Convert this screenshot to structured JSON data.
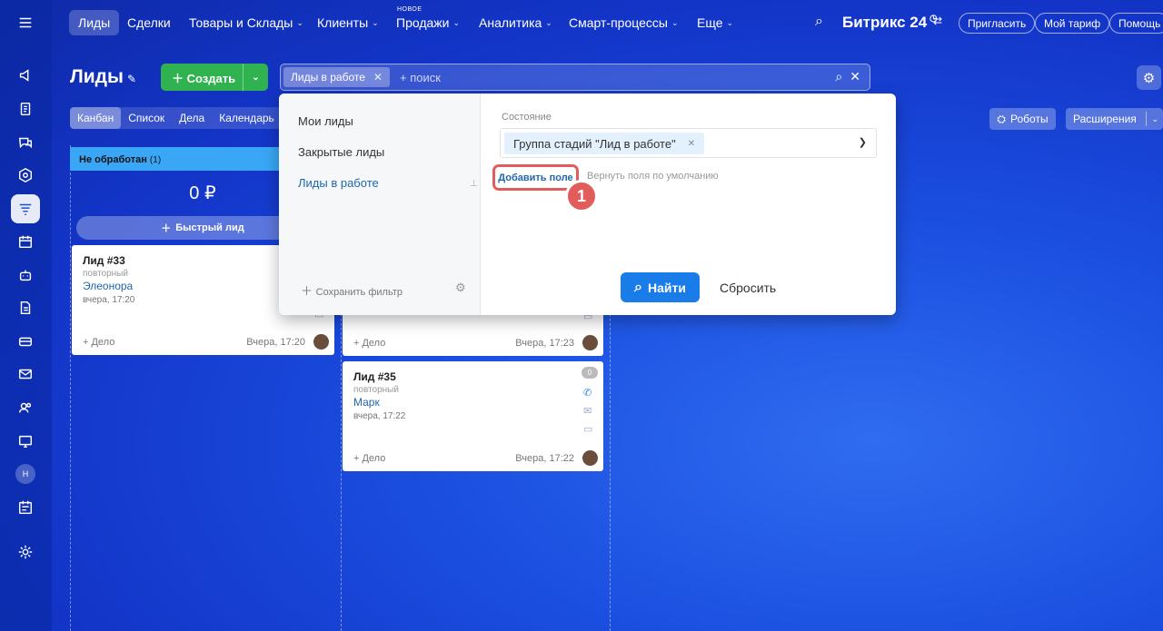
{
  "rail": {
    "icons": [
      "menu-icon",
      "megaphone-icon",
      "document-icon",
      "chat-icon",
      "hexagon-icon",
      "funnel-icon",
      "calendar-icon",
      "robot-icon",
      "file-icon",
      "card-icon",
      "mail-icon",
      "users-icon",
      "screen-icon",
      "avatar",
      "tasks-icon",
      "settings-icon"
    ],
    "avatar_initial": "Н"
  },
  "topnav": {
    "items": [
      {
        "label": "Лиды",
        "active": true
      },
      {
        "label": "Сделки"
      },
      {
        "label": "Товары и Склады",
        "chev": true
      },
      {
        "label": "Клиенты",
        "chev": true
      },
      {
        "label": "Продажи",
        "chev": true
      },
      {
        "label": "Аналитика",
        "chev": true
      },
      {
        "label": "Смарт-процессы",
        "chev": true
      },
      {
        "label": "Еще",
        "chev": true
      }
    ],
    "new_tag": "НОВОЕ",
    "brand": "Битрикс 24",
    "invite": "Пригласить",
    "plan": "Мой тариф",
    "help": "Помощь"
  },
  "header": {
    "title": "Лиды",
    "create": "Создать",
    "filter_chip": "Лиды в работе",
    "search_placeholder": "+ поиск"
  },
  "view_tabs": [
    "Канбан",
    "Список",
    "Дела",
    "Календарь"
  ],
  "robots": "Роботы",
  "extensions": "Расширения",
  "column": {
    "title": "Не обработан",
    "count": "(1)",
    "sum": "0 ₽",
    "quick_lead": "Быстрый лид"
  },
  "cards": [
    {
      "title": "Лид #33",
      "sub": "повторный",
      "name": "Элеонора",
      "date": "вчера, 17:20",
      "deal": "+ Дело",
      "time": "Вчера, 17:20"
    },
    {
      "deal": "+ Дело",
      "time": "Вчера, 17:23"
    },
    {
      "title": "Лид #35",
      "sub": "повторный",
      "name": "Марк",
      "date": "вчера, 17:22",
      "deal": "+ Дело",
      "time": "Вчера, 17:22",
      "badge": "0"
    }
  ],
  "filter_popup": {
    "presets": [
      "Мои лиды",
      "Закрытые лиды",
      "Лиды в работе"
    ],
    "save_filter": "Сохранить фильтр",
    "field_label": "Состояние",
    "field_value": "Группа стадий \"Лид в работе\"",
    "add_field": "Добавить поле",
    "reset_fields": "Вернуть поля по умолчанию",
    "step_number": "1",
    "find": "Найти",
    "reset": "Сбросить"
  }
}
